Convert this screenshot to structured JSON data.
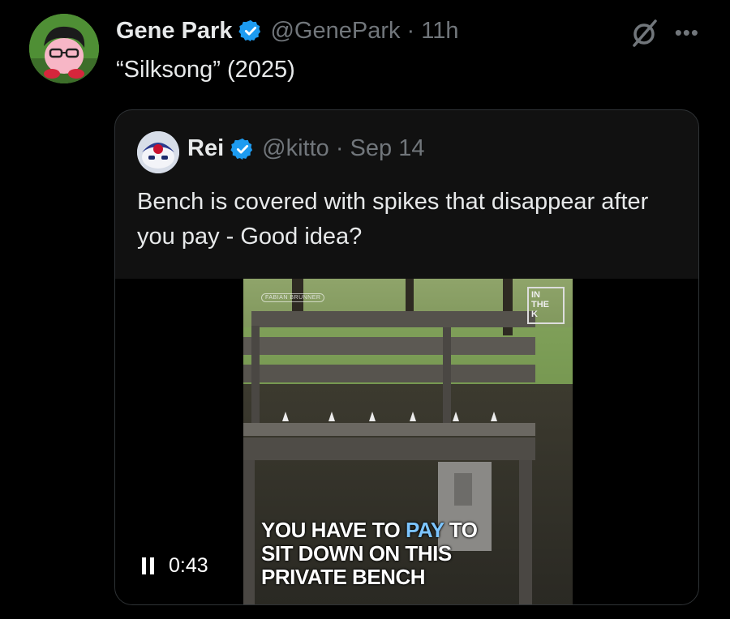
{
  "tweet": {
    "author_name": "Gene Park",
    "author_handle": "@GenePark · 11h",
    "text": "“Silksong” (2025)"
  },
  "quoted_tweet": {
    "author_name": "Rei",
    "author_handle": "@kitto · Sep 14",
    "text": "Bench is covered with spikes that disappear after you pay - Good idea?"
  },
  "video": {
    "time": "0:43",
    "caption_parts": [
      "YOU HAVE TO ",
      "PAY",
      " TO",
      "SIT DOWN ON THIS",
      "PRIVATE BENCH"
    ],
    "watermark": "FABIAN BRUNNER",
    "logo": [
      "IN",
      "THE",
      "K"
    ]
  },
  "icons": {
    "verified": "verified-badge-icon",
    "grok": "grok-icon",
    "more": "more-options-icon",
    "pause": "pause-icon"
  },
  "colors": {
    "background": "#000000",
    "text": "#e7e9ea",
    "muted": "#71767b",
    "verified": "#1d9bf0",
    "caption_accent": "#7cc4ff"
  }
}
